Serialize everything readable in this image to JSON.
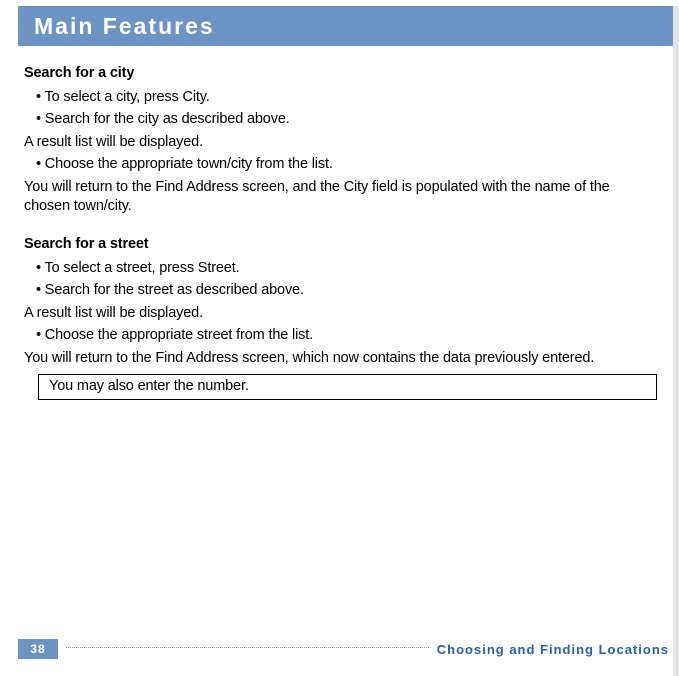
{
  "header": {
    "title": "Main Features"
  },
  "sections": {
    "city": {
      "heading": "Search for a city",
      "b1": "• To select a city, press City.",
      "b2": "• Search for the city as described above.",
      "l1": "A result list will be displayed.",
      "b3": "• Choose the appropriate town/city from the list.",
      "l2": "You will return to the Find Address screen, and the City field is populated with the name of the chosen town/city."
    },
    "street": {
      "heading": "Search for a street",
      "b1": "• To select a street, press Street.",
      "b2": "• Search for the street as described above.",
      "l1": "A result list will be displayed.",
      "b3": "• Choose the appropriate street from the list.",
      "l2": "You will return to the Find Address screen, which now contains the data previously entered.",
      "note": "You may also enter the number."
    }
  },
  "footer": {
    "page": "38",
    "section": "Choosing and Finding Locations"
  }
}
